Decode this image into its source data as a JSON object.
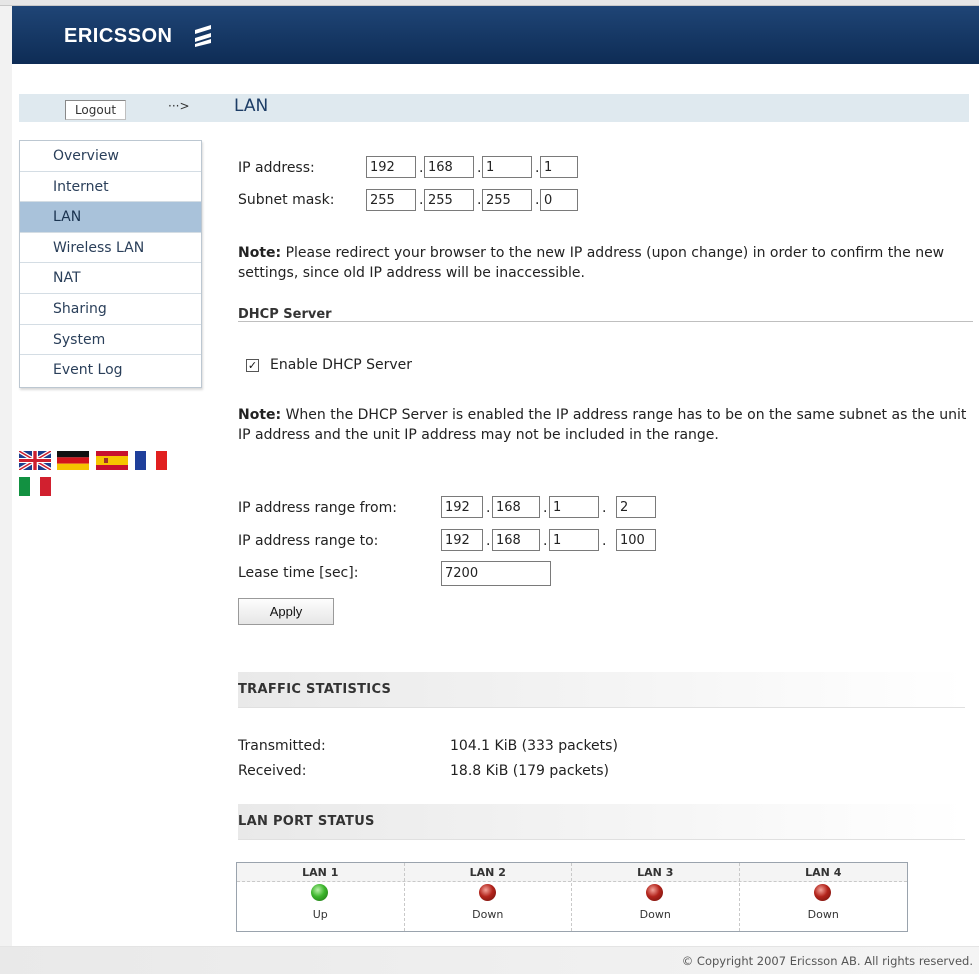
{
  "header": {
    "brand": "ERICSSON"
  },
  "topbar": {
    "logout_label": "Logout",
    "arrow": "···>",
    "page_title": "LAN"
  },
  "sidebar": {
    "items": [
      {
        "label": "Overview"
      },
      {
        "label": "Internet"
      },
      {
        "label": "LAN",
        "active": true
      },
      {
        "label": "Wireless LAN"
      },
      {
        "label": "NAT"
      },
      {
        "label": "Sharing"
      },
      {
        "label": "System"
      },
      {
        "label": "Event Log"
      }
    ]
  },
  "languages": [
    "english-flag-icon",
    "german-flag-icon",
    "spanish-flag-icon",
    "french-flag-icon",
    "italian-flag-icon"
  ],
  "lan": {
    "ip_label": "IP address:",
    "ip": [
      "192",
      "168",
      "1",
      "1"
    ],
    "subnet_label": "Subnet mask:",
    "subnet": [
      "255",
      "255",
      "255",
      "0"
    ],
    "note_bold": "Note:",
    "note_text": " Please redirect your browser to the new IP address (upon change) in order to confirm the new settings, since old IP address will be inaccessible."
  },
  "dhcp": {
    "section_title": "DHCP Server",
    "enable_label": "Enable DHCP Server",
    "enabled": true,
    "note_bold": "Note:",
    "note_text": " When the DHCP Server is enabled the IP address range has to be on the same subnet as the unit IP address and the unit IP address may not be included in the range.",
    "range_from_label": "IP address range from:",
    "range_from": [
      "192",
      "168",
      "1",
      "2"
    ],
    "range_to_label": "IP address range to:",
    "range_to": [
      "192",
      "168",
      "1",
      "100"
    ],
    "lease_label": "Lease time [sec]:",
    "lease_value": "7200",
    "apply_label": "Apply"
  },
  "traffic": {
    "title": "TRAFFIC STATISTICS",
    "transmitted_label": "Transmitted:",
    "transmitted_value": "104.1 KiB (333 packets)",
    "received_label": "Received:",
    "received_value": "18.8 KiB (179 packets)"
  },
  "ports": {
    "title": "LAN PORT STATUS",
    "items": [
      {
        "name": "LAN 1",
        "status": "Up",
        "color": "#3cb52c"
      },
      {
        "name": "LAN 2",
        "status": "Down",
        "color": "#b3241c"
      },
      {
        "name": "LAN 3",
        "status": "Down",
        "color": "#b3241c"
      },
      {
        "name": "LAN 4",
        "status": "Down",
        "color": "#b3241c"
      }
    ]
  },
  "footer": {
    "copyright": "© Copyright 2007 Ericsson AB. All rights reserved."
  },
  "colors": {
    "header_bg": "#16386a",
    "active_nav": "#a9c2da",
    "topbar_bg": "#dfe9ef"
  }
}
